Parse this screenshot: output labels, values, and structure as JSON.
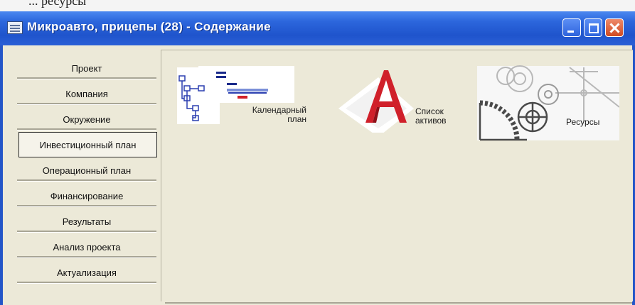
{
  "top_strip_text": "... ресурсы",
  "window": {
    "title": "Микроавто, прицепы (28) - Содержание",
    "minimize_label": "",
    "maximize_label": "",
    "close_label": ""
  },
  "sidebar": {
    "items": [
      {
        "label": "Проект",
        "active": false
      },
      {
        "label": "Компания",
        "active": false
      },
      {
        "label": "Окружение",
        "active": false
      },
      {
        "label": "Инвестиционный план",
        "active": true
      },
      {
        "label": "Операционный план",
        "active": false
      },
      {
        "label": "Финансирование",
        "active": false
      },
      {
        "label": "Результаты",
        "active": false
      },
      {
        "label": "Анализ проекта",
        "active": false
      },
      {
        "label": "Актуализация",
        "active": false
      }
    ]
  },
  "tiles": {
    "calendar_line1": "Календарный",
    "calendar_line2": "план",
    "assets_line1": "Список",
    "assets_line2": "активов",
    "resources_label": "Ресурсы"
  },
  "colors": {
    "titlebar": "#2456c8",
    "client_bg": "#ece9d8",
    "close_button": "#d04a22",
    "accent_red": "#d0202a",
    "diagram_blue": "#2b3fb0"
  },
  "icons": [
    "app-window-icon",
    "minimize-icon",
    "maximize-icon",
    "close-icon",
    "calendar-plan-icon",
    "asset-list-icon",
    "resources-gears-icon"
  ]
}
